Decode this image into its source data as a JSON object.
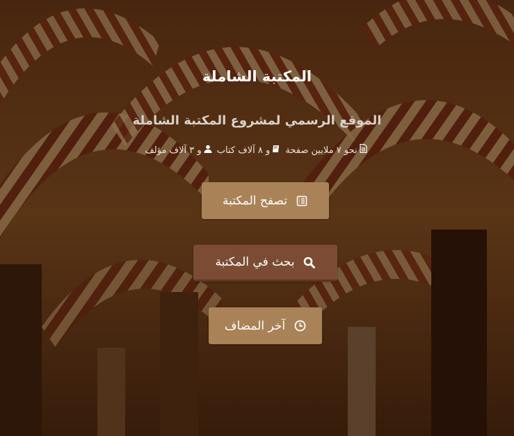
{
  "hero": {
    "title": "المكتبة الشاملة",
    "subtitle": "الموقع الرسمي لمشروع المكتبة الشاملة",
    "stats": {
      "pages_icon": "file-text-icon",
      "pages_text": "نحو ٧ ملايين صفحة",
      "books_icon": "book-icon",
      "books_text": "و ٨ آلاف كتاب",
      "authors_icon": "user-icon",
      "authors_text": "و ٣ آلاف مؤلف"
    }
  },
  "buttons": {
    "browse": {
      "label": "تصفح المكتبة",
      "icon": "list-icon",
      "color": "#a98257"
    },
    "search": {
      "label": "بحث في المكتبة",
      "icon": "search-icon",
      "color": "#7b4c33"
    },
    "latest": {
      "label": "آخر المضاف",
      "icon": "clock-icon",
      "color": "#a98257"
    }
  }
}
